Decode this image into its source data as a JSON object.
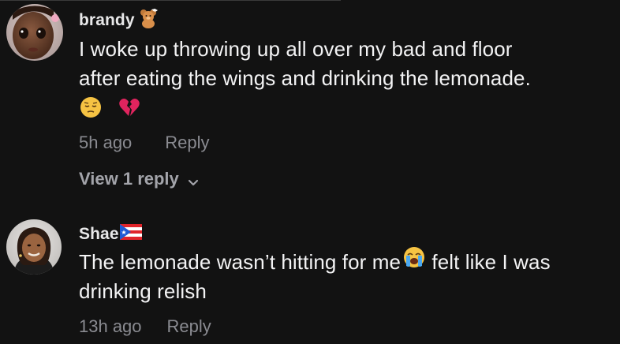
{
  "comments": [
    {
      "username": "brandy",
      "badge_icon": "teddy-bear-emoji",
      "lines": [
        "I woke up throwing up all over my bad and floor",
        "after eating the wings and drinking the lemonade."
      ],
      "trailing_icons": [
        "pensive-face-emoji",
        "broken-heart-emoji"
      ],
      "time": "5h ago",
      "reply_label": "Reply",
      "view_replies_label": "View 1 reply"
    },
    {
      "username": "Shae",
      "badge_icon": "puerto-rico-flag-emoji",
      "lines": [
        "The lemonade wasn’t hitting for me",
        " felt like I was",
        "drinking relish"
      ],
      "inline_icon": "loudly-crying-face-emoji",
      "time": "13h ago",
      "reply_label": "Reply"
    }
  ],
  "colors": {
    "background": "#121212",
    "text": "#f3f3f4",
    "muted": "#8a8b91"
  }
}
